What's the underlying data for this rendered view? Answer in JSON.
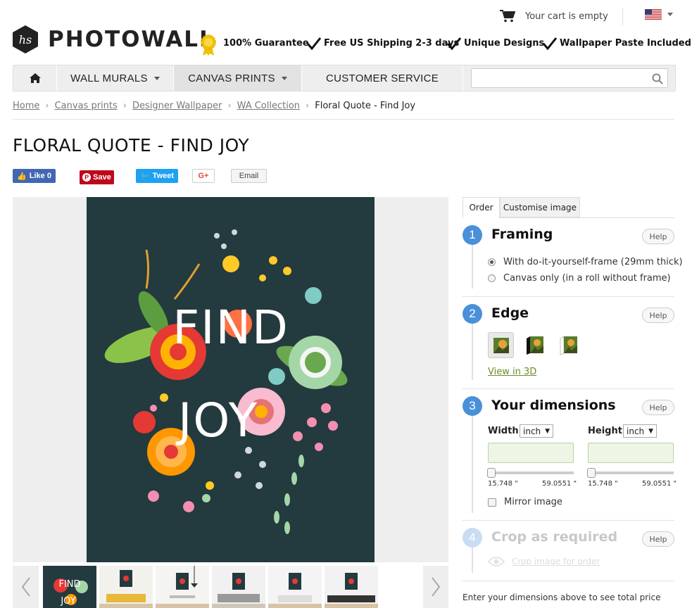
{
  "header": {
    "brand": "PHOTOWALL",
    "cart_text": "Your cart is empty",
    "guarantees": [
      "100% Guarantee",
      "Free US Shipping 2-3 days",
      "Unique Designs",
      "Wallpaper Paste Included"
    ]
  },
  "nav": {
    "items": [
      "WALL MURALS",
      "CANVAS PRINTS",
      "CUSTOMER SERVICE"
    ],
    "search_placeholder": ""
  },
  "breadcrumb": [
    "Home",
    "Canvas prints",
    "Designer Wallpaper",
    "WA Collection",
    "Floral Quote - Find Joy"
  ],
  "product": {
    "title": "FLORAL QUOTE - FIND JOY",
    "image_text": [
      "FIND",
      "JOY"
    ]
  },
  "social": {
    "like": "Like 0",
    "save": "Save",
    "tweet": "Tweet",
    "gplus": "G+",
    "email": "Email"
  },
  "tabs": [
    "Order",
    "Customise image"
  ],
  "steps": {
    "framing": {
      "number": "1",
      "title": "Framing",
      "help": "Help",
      "options": [
        "With do-it-yourself-frame (29mm thick)",
        "Canvas only (in a roll without frame)"
      ]
    },
    "edge": {
      "number": "2",
      "title": "Edge",
      "help": "Help",
      "view3d": "View in 3D"
    },
    "dimensions": {
      "number": "3",
      "title": "Your dimensions",
      "help": "Help",
      "width_label": "Width",
      "height_label": "Height",
      "unit": "inch",
      "width_value": "",
      "height_value": "",
      "min": "15.748 \"",
      "max": "59.0551 \"",
      "mirror": "Mirror image"
    },
    "crop": {
      "number": "4",
      "title": "Crop as required",
      "help": "Help",
      "link": "Crop image for order"
    }
  },
  "price_note": "Enter your dimensions above to see total price",
  "colors": {
    "accent": "#4a90d9",
    "poster_bg": "#233a3f",
    "link_green": "#6a8a2a"
  }
}
